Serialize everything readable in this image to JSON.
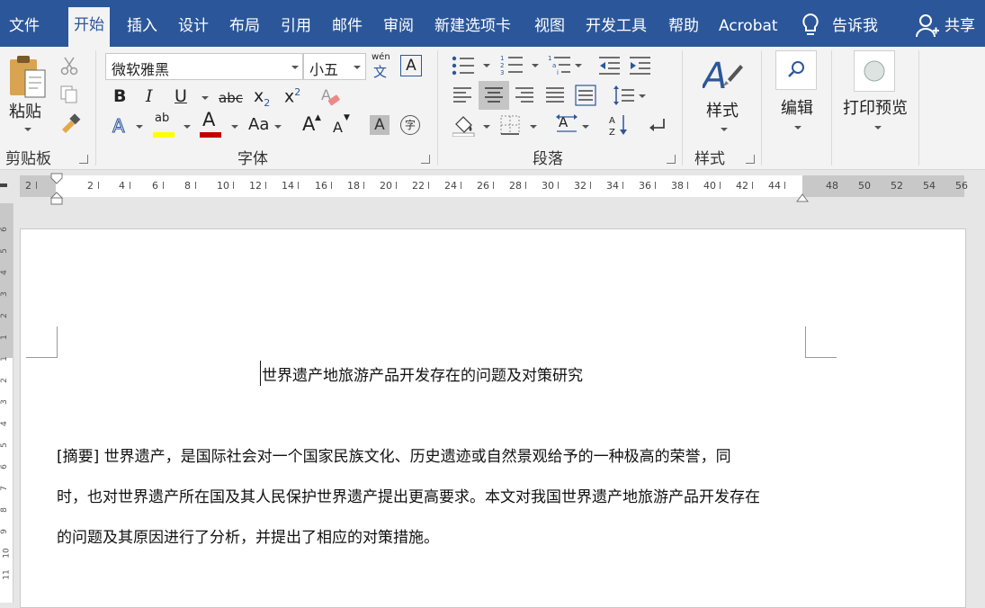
{
  "tabs": [
    {
      "label": "文件",
      "active": false
    },
    {
      "label": "开始",
      "active": true
    },
    {
      "label": "插入",
      "active": false
    },
    {
      "label": "设计",
      "active": false
    },
    {
      "label": "布局",
      "active": false
    },
    {
      "label": "引用",
      "active": false
    },
    {
      "label": "邮件",
      "active": false
    },
    {
      "label": "审阅",
      "active": false
    },
    {
      "label": "新建选项卡",
      "active": false
    },
    {
      "label": "视图",
      "active": false
    },
    {
      "label": "开发工具",
      "active": false
    },
    {
      "label": "帮助",
      "active": false
    },
    {
      "label": "Acrobat",
      "active": false
    }
  ],
  "tellme": {
    "label": "告诉我",
    "icon": "lightbulb-icon"
  },
  "share": {
    "label": "共享",
    "icon": "person-add-icon"
  },
  "clipboard": {
    "paste_label": "粘贴",
    "group_label": "剪贴板"
  },
  "font": {
    "family": "微软雅黑",
    "size": "小五",
    "group_label": "字体",
    "phonetic_top": "wén",
    "phonetic_bottom": "文",
    "char_border": "A",
    "bold": "B",
    "italic": "I",
    "underline": "U",
    "strike": "abc",
    "subscript": "x",
    "subscript_sub": "2",
    "superscript": "x",
    "superscript_sup": "2",
    "highlight_sample": "ab",
    "font_color_sample": "A",
    "change_case": "Aa",
    "grow": "A",
    "shrink": "A",
    "shading_sample": "A",
    "enclose": "字",
    "highlight_color": "#ffff00",
    "font_color": "#c00000"
  },
  "paragraph": {
    "group_label": "段落"
  },
  "styles": {
    "label": "样式",
    "group_label": "样式"
  },
  "editing": {
    "label": "编辑"
  },
  "print_preview": {
    "label": "打印预览"
  },
  "ruler": {
    "labels_left": [
      "2",
      "2",
      "4",
      "6",
      "8",
      "10",
      "12",
      "14",
      "16",
      "18",
      "20",
      "22",
      "24",
      "26",
      "28",
      "30",
      "32",
      "34",
      "36",
      "38",
      "40",
      "42",
      "44"
    ],
    "labels_right": [
      "48",
      "50",
      "52",
      "54",
      "56"
    ]
  },
  "vruler": {
    "labels": [
      "6",
      "5",
      "4",
      "3",
      "2",
      "1",
      "1",
      "2",
      "3",
      "4",
      "5",
      "6",
      "7",
      "8",
      "9",
      "10",
      "11"
    ]
  },
  "document": {
    "title": "世界遗产地旅游产品开发存在的问题及对策研究",
    "lines": [
      "[摘要]  世界遗产，是国际社会对一个国家民族文化、历史遗迹或自然景观给予的一种极高的荣誉，同",
      "时，也对世界遗产所在国及其人民保护世界遗产提出更高要求。本文对我国世界遗产地旅游产品开发存在",
      "的问题及其原因进行了分析，并提出了相应的对策措施。"
    ]
  },
  "colors": {
    "accent": "#2b579a",
    "ribbon_bg": "#f3f3f3",
    "icon_blue": "#2b579a"
  }
}
